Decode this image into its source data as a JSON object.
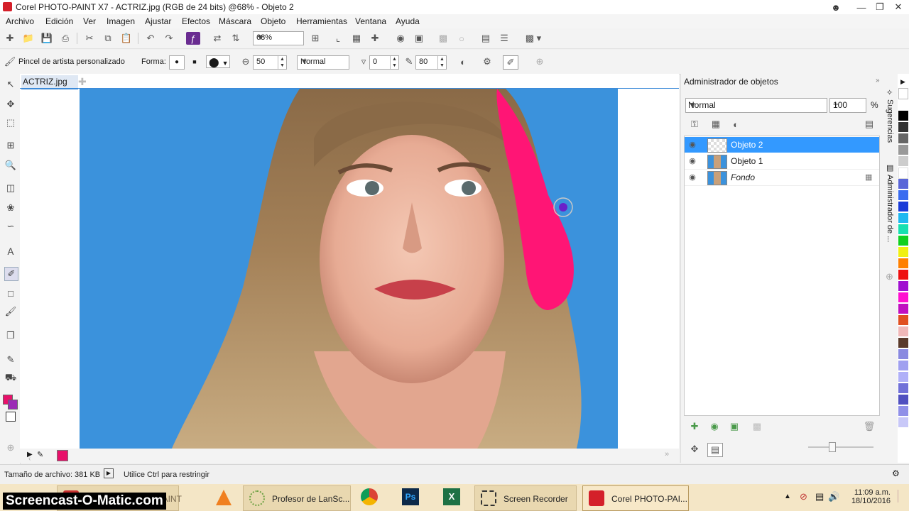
{
  "window": {
    "title": "Corel PHOTO-PAINT X7 - ACTRIZ.jpg (RGB de 24 bits) @68% - Objeto 2"
  },
  "menu": [
    "Archivo",
    "Edición",
    "Ver",
    "Imagen",
    "Ajustar",
    "Efectos",
    "Máscara",
    "Objeto",
    "Herramientas",
    "Ventana",
    "Ayuda"
  ],
  "toolbar": {
    "zoom": "68%"
  },
  "property_bar": {
    "tool_name": "Pincel de artista personalizado",
    "forma_label": "Forma:",
    "size": "50",
    "blend_mode": "Normal",
    "transparency": "0",
    "opacity": "80"
  },
  "document": {
    "tab": "ACTRIZ.jpg"
  },
  "colors": {
    "accent": "#3c8ad9",
    "selection": "#3399ff",
    "brush_stroke": "#ff1575",
    "canvas_background": "#3b92dc",
    "foreground": "#e8106a",
    "background": "#9b2bb5"
  },
  "object_manager": {
    "title": "Administrador de objetos",
    "blend_mode": "Normal",
    "opacity": "100",
    "percent": "%",
    "layers": [
      {
        "name": "Objeto 2",
        "selected": true
      },
      {
        "name": "Objeto 1",
        "selected": false
      },
      {
        "name": "Fondo",
        "selected": false
      }
    ]
  },
  "side_tabs": {
    "sugerencias": "Sugerencias",
    "administrador": "Administrador de ..."
  },
  "status": {
    "file_size": "Tamaño de archivo: 381 KB",
    "hint": "Utilice Ctrl para restringir"
  },
  "taskbar": {
    "items": [
      "PHOTO-PAINT",
      "Profesor de LanSc...",
      "Screen Recorder",
      "Corel PHOTO-PAI..."
    ],
    "time": "11:09 a.m.",
    "date": "18/10/2016",
    "watermark": "Screencast-O-Matic.com"
  }
}
